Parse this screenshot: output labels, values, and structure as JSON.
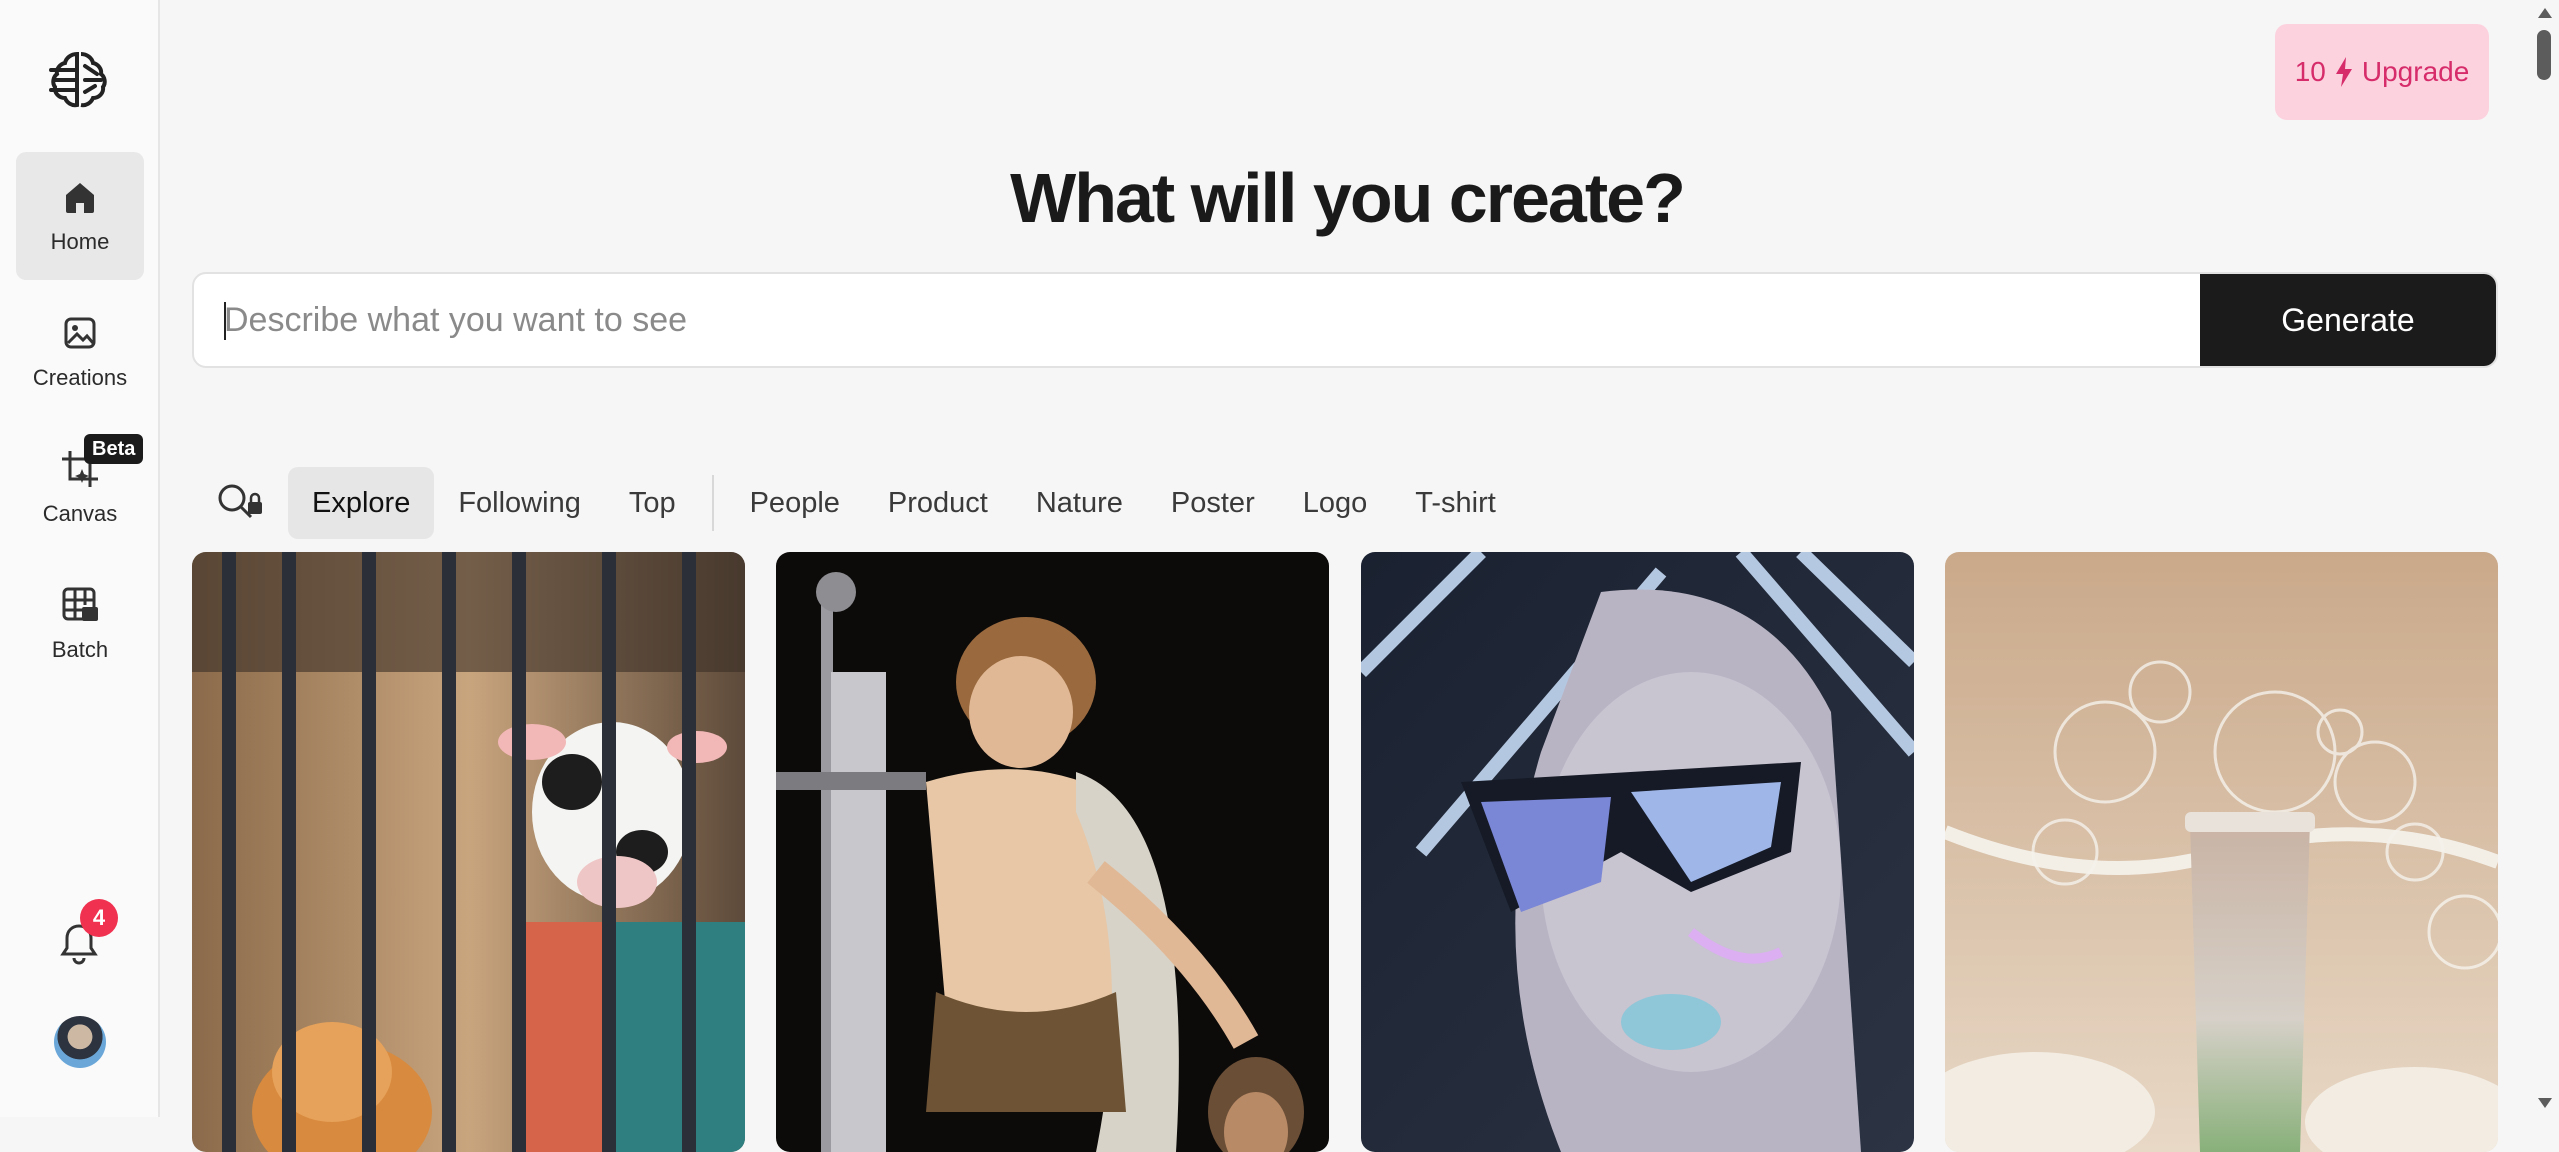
{
  "header": {
    "credits": "10",
    "upgrade_label": "Upgrade",
    "headline": "What will you create?"
  },
  "prompt": {
    "placeholder": "Describe what you want to see",
    "generate_label": "Generate"
  },
  "sidebar": {
    "items": [
      {
        "label": "Home",
        "icon": "home-icon",
        "active": true
      },
      {
        "label": "Creations",
        "icon": "image-icon",
        "active": false
      },
      {
        "label": "Canvas",
        "icon": "canvas-crop-icon",
        "active": false,
        "badge": "Beta"
      },
      {
        "label": "Batch",
        "icon": "batch-grid-icon",
        "active": false
      }
    ],
    "notifications_count": "4"
  },
  "filters": {
    "primary": [
      "Explore",
      "Following",
      "Top"
    ],
    "categories": [
      "People",
      "Product",
      "Nature",
      "Poster",
      "Logo",
      "T-shirt"
    ],
    "active": "Explore"
  },
  "gallery": [
    {
      "subject": "cow-in-jail-with-cat"
    },
    {
      "subject": "boy-with-sword-painting"
    },
    {
      "subject": "woman-with-futuristic-sunglasses"
    },
    {
      "subject": "cosmetic-tube-with-bubbles"
    }
  ],
  "colors": {
    "accent_pink_bg": "#fcd2df",
    "accent_pink_text": "#d62c6a",
    "dark": "#1b1b1b",
    "badge_red": "#f0314f"
  }
}
